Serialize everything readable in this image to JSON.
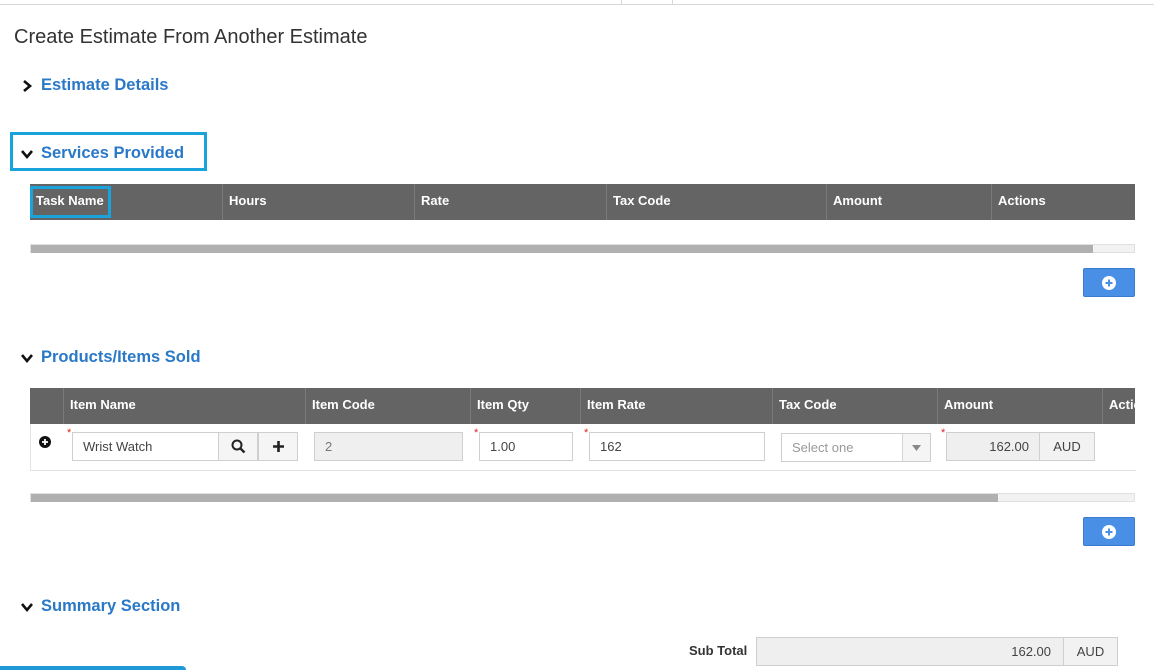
{
  "page": {
    "title": "Create Estimate From Another Estimate"
  },
  "sections": {
    "estimate_details": {
      "label": "Estimate Details"
    },
    "services_provided": {
      "label": "Services Provided",
      "columns": [
        "Task Name",
        "Hours",
        "Rate",
        "Tax Code",
        "Amount",
        "Actions"
      ]
    },
    "products_sold": {
      "label": "Products/Items Sold",
      "columns": [
        "Item Name",
        "Item Code",
        "Item Qty",
        "Item Rate",
        "Tax Code",
        "Amount",
        "Actions"
      ],
      "row": {
        "item_name": "Wrist Watch",
        "item_code": "2",
        "item_qty": "1.00",
        "item_rate": "162",
        "tax_code_placeholder": "Select one",
        "amount": "162.00",
        "currency": "AUD"
      }
    },
    "summary": {
      "label": "Summary Section",
      "sub_total_label": "Sub Total",
      "sub_total_value": "162.00",
      "currency": "AUD"
    }
  },
  "icons": {
    "expand": "chevron-right-icon",
    "collapse": "chevron-down-icon",
    "add": "plus-circle-icon",
    "search": "search-icon",
    "plus": "plus-icon",
    "dropdown": "caret-down-icon"
  },
  "colors": {
    "accent": "#2a78c8",
    "highlight": "#1aa3db",
    "header_bg": "#646464",
    "button": "#4a8fe6"
  }
}
